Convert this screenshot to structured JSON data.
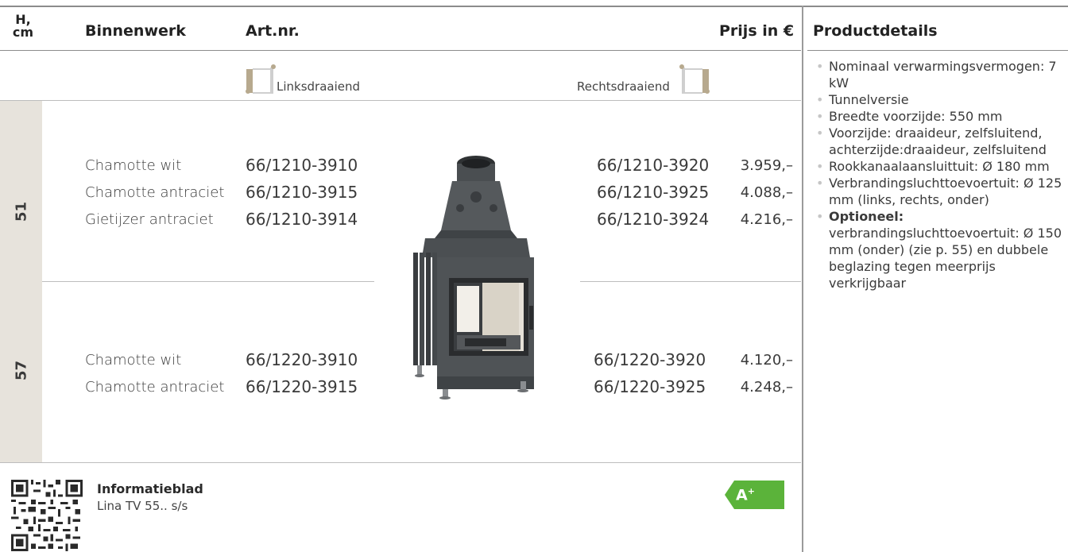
{
  "header": {
    "h_label": "H,",
    "h_unit": "cm",
    "binnenwerk": "Binnenwerk",
    "artnr": "Art.nr.",
    "prijs": "Prijs in €",
    "productdetails": "Productdetails"
  },
  "doors": {
    "left_label": "Linksdraaiend",
    "right_label": "Rechtsdraaiend"
  },
  "groups": [
    {
      "height": "51",
      "rows": [
        {
          "binnenwerk": "Chamotte wit",
          "art_left": "66/1210-3910",
          "art_right": "66/1210-3920",
          "price": "3.959,–"
        },
        {
          "binnenwerk": "Chamotte antraciet",
          "art_left": "66/1210-3915",
          "art_right": "66/1210-3925",
          "price": "4.088,–"
        },
        {
          "binnenwerk": "Gietijzer antraciet",
          "art_left": "66/1210-3914",
          "art_right": "66/1210-3924",
          "price": "4.216,–"
        }
      ]
    },
    {
      "height": "57",
      "rows": [
        {
          "binnenwerk": "Chamotte wit",
          "art_left": "66/1220-3910",
          "art_right": "66/1220-3920",
          "price": "4.120,–"
        },
        {
          "binnenwerk": "Chamotte antraciet",
          "art_left": "66/1220-3915",
          "art_right": "66/1220-3925",
          "price": "4.248,–"
        }
      ]
    }
  ],
  "details": {
    "items": [
      "Nominaal verwarmingsvermogen: 7 kW",
      "Tunnelversie",
      "Breedte voorzijde: 550 mm",
      "Voorzijde: draaideur, zelfsluitend, achterzijde:draaideur, zelfsluitend",
      "Rookkanaalaansluittuit: Ø 180 mm",
      "Verbrandingsluchttoevoertuit: Ø 125 mm (links, rechts, onder)"
    ],
    "optional_label": "Optioneel:",
    "optional_text": "verbrandingsluchttoevoertuit: Ø 150 mm (onder) (zie p. 55) en dubbele beglazing tegen meerprijs verkrijgbaar"
  },
  "footer": {
    "title": "Informatieblad",
    "subtitle": "Lina TV 55.. s/s",
    "energy_class": "A",
    "energy_sup": "+"
  },
  "colors": {
    "energy_green": "#5bb33a",
    "side_band": "#e7e3dc",
    "stove_dark": "#3b3e40"
  }
}
